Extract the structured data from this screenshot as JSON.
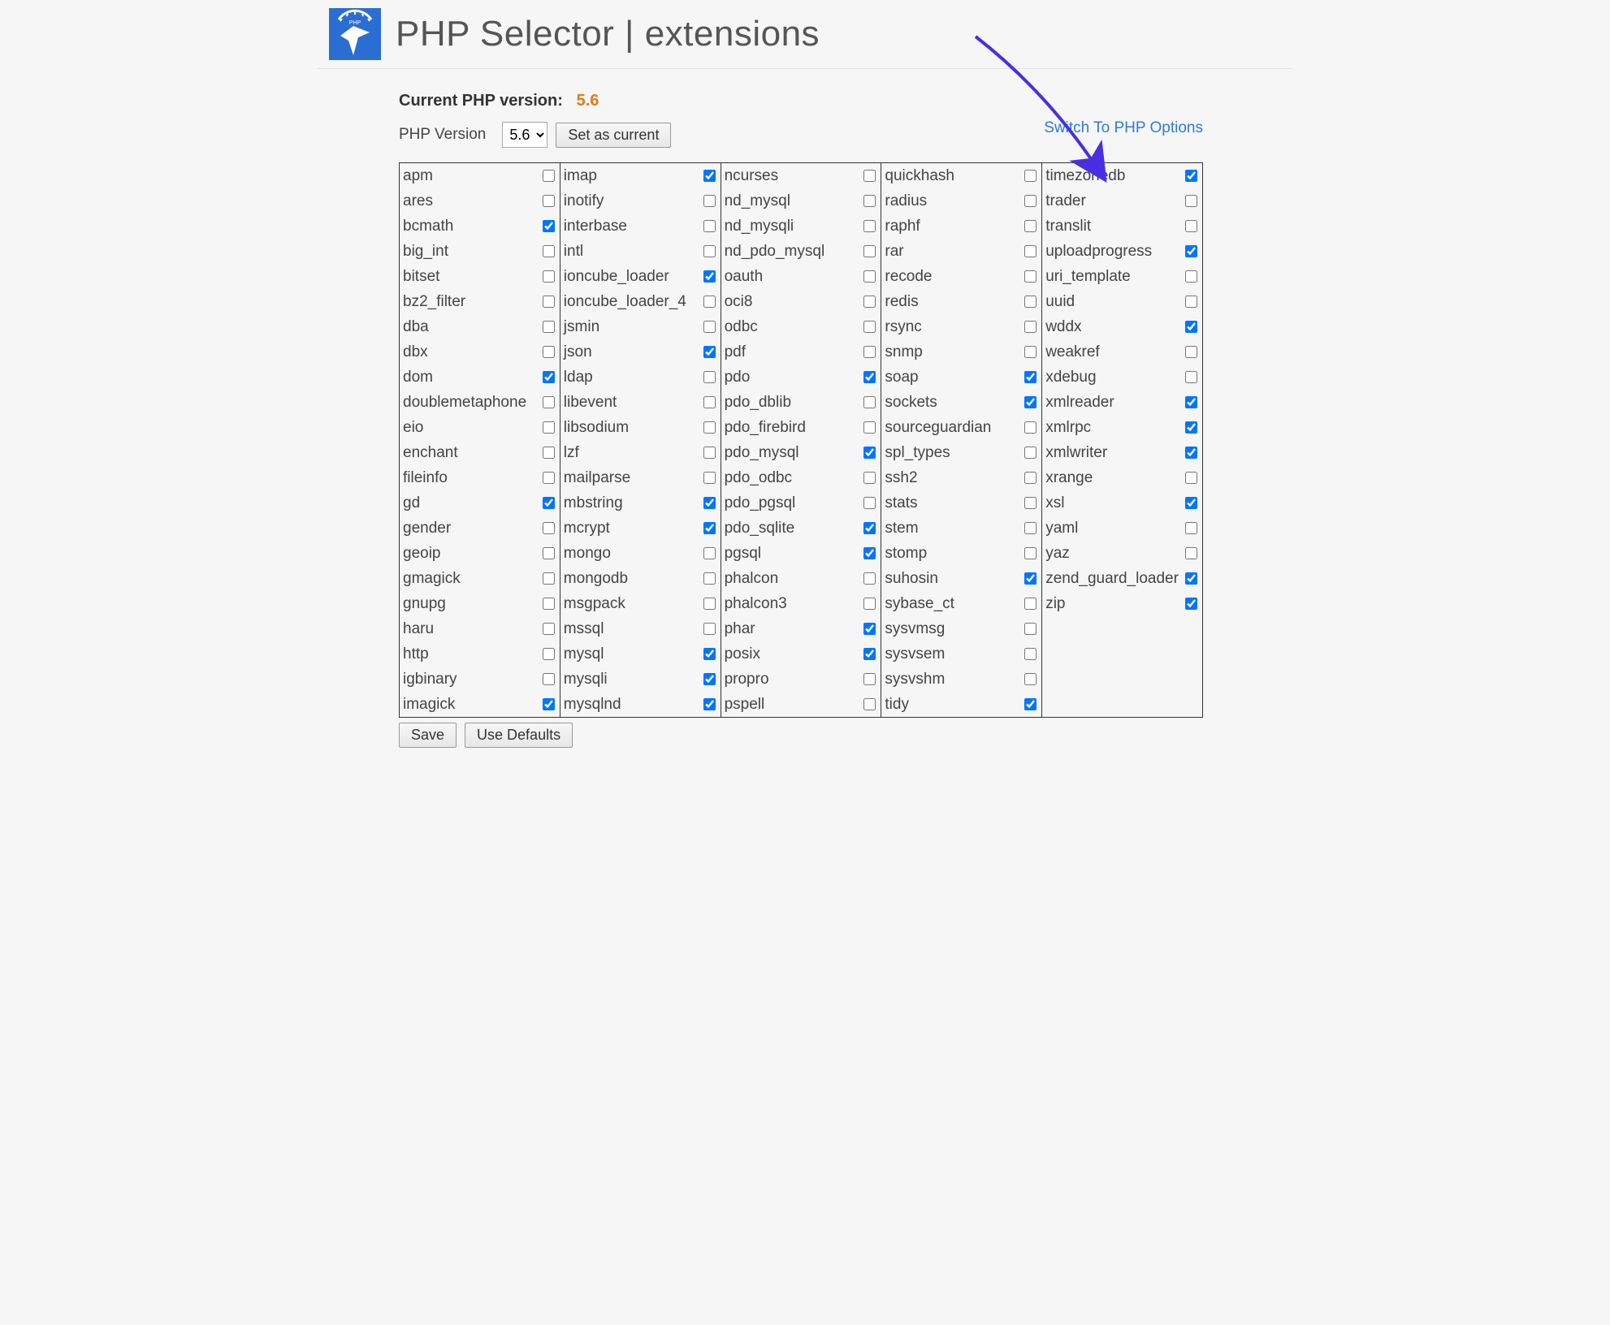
{
  "header": {
    "title": "PHP Selector | extensions"
  },
  "version": {
    "current_label": "Current PHP version:",
    "current_value": "5.6",
    "selector_label": "PHP Version",
    "selected": "5.6",
    "options": [
      "5.6"
    ],
    "set_button": "Set as current"
  },
  "switch_link": "Switch To PHP Options",
  "buttons": {
    "save": "Save",
    "defaults": "Use Defaults"
  },
  "columns": [
    [
      {
        "name": "apm",
        "checked": false
      },
      {
        "name": "ares",
        "checked": false
      },
      {
        "name": "bcmath",
        "checked": true
      },
      {
        "name": "big_int",
        "checked": false
      },
      {
        "name": "bitset",
        "checked": false
      },
      {
        "name": "bz2_filter",
        "checked": false
      },
      {
        "name": "dba",
        "checked": false
      },
      {
        "name": "dbx",
        "checked": false
      },
      {
        "name": "dom",
        "checked": true
      },
      {
        "name": "doublemetaphone",
        "checked": false
      },
      {
        "name": "eio",
        "checked": false
      },
      {
        "name": "enchant",
        "checked": false
      },
      {
        "name": "fileinfo",
        "checked": false
      },
      {
        "name": "gd",
        "checked": true
      },
      {
        "name": "gender",
        "checked": false
      },
      {
        "name": "geoip",
        "checked": false
      },
      {
        "name": "gmagick",
        "checked": false
      },
      {
        "name": "gnupg",
        "checked": false
      },
      {
        "name": "haru",
        "checked": false
      },
      {
        "name": "http",
        "checked": false
      },
      {
        "name": "igbinary",
        "checked": false
      },
      {
        "name": "imagick",
        "checked": true
      }
    ],
    [
      {
        "name": "imap",
        "checked": true
      },
      {
        "name": "inotify",
        "checked": false
      },
      {
        "name": "interbase",
        "checked": false
      },
      {
        "name": "intl",
        "checked": false
      },
      {
        "name": "ioncube_loader",
        "checked": true
      },
      {
        "name": "ioncube_loader_4",
        "checked": false
      },
      {
        "name": "jsmin",
        "checked": false
      },
      {
        "name": "json",
        "checked": true
      },
      {
        "name": "ldap",
        "checked": false
      },
      {
        "name": "libevent",
        "checked": false
      },
      {
        "name": "libsodium",
        "checked": false
      },
      {
        "name": "lzf",
        "checked": false
      },
      {
        "name": "mailparse",
        "checked": false
      },
      {
        "name": "mbstring",
        "checked": true
      },
      {
        "name": "mcrypt",
        "checked": true
      },
      {
        "name": "mongo",
        "checked": false
      },
      {
        "name": "mongodb",
        "checked": false
      },
      {
        "name": "msgpack",
        "checked": false
      },
      {
        "name": "mssql",
        "checked": false
      },
      {
        "name": "mysql",
        "checked": true
      },
      {
        "name": "mysqli",
        "checked": true
      },
      {
        "name": "mysqlnd",
        "checked": true
      }
    ],
    [
      {
        "name": "ncurses",
        "checked": false
      },
      {
        "name": "nd_mysql",
        "checked": false
      },
      {
        "name": "nd_mysqli",
        "checked": false
      },
      {
        "name": "nd_pdo_mysql",
        "checked": false
      },
      {
        "name": "oauth",
        "checked": false
      },
      {
        "name": "oci8",
        "checked": false
      },
      {
        "name": "odbc",
        "checked": false
      },
      {
        "name": "pdf",
        "checked": false
      },
      {
        "name": "pdo",
        "checked": true
      },
      {
        "name": "pdo_dblib",
        "checked": false
      },
      {
        "name": "pdo_firebird",
        "checked": false
      },
      {
        "name": "pdo_mysql",
        "checked": true
      },
      {
        "name": "pdo_odbc",
        "checked": false
      },
      {
        "name": "pdo_pgsql",
        "checked": false
      },
      {
        "name": "pdo_sqlite",
        "checked": true
      },
      {
        "name": "pgsql",
        "checked": true
      },
      {
        "name": "phalcon",
        "checked": false
      },
      {
        "name": "phalcon3",
        "checked": false
      },
      {
        "name": "phar",
        "checked": true
      },
      {
        "name": "posix",
        "checked": true
      },
      {
        "name": "propro",
        "checked": false
      },
      {
        "name": "pspell",
        "checked": false
      }
    ],
    [
      {
        "name": "quickhash",
        "checked": false
      },
      {
        "name": "radius",
        "checked": false
      },
      {
        "name": "raphf",
        "checked": false
      },
      {
        "name": "rar",
        "checked": false
      },
      {
        "name": "recode",
        "checked": false
      },
      {
        "name": "redis",
        "checked": false
      },
      {
        "name": "rsync",
        "checked": false
      },
      {
        "name": "snmp",
        "checked": false
      },
      {
        "name": "soap",
        "checked": true
      },
      {
        "name": "sockets",
        "checked": true
      },
      {
        "name": "sourceguardian",
        "checked": false
      },
      {
        "name": "spl_types",
        "checked": false
      },
      {
        "name": "ssh2",
        "checked": false
      },
      {
        "name": "stats",
        "checked": false
      },
      {
        "name": "stem",
        "checked": false
      },
      {
        "name": "stomp",
        "checked": false
      },
      {
        "name": "suhosin",
        "checked": true
      },
      {
        "name": "sybase_ct",
        "checked": false
      },
      {
        "name": "sysvmsg",
        "checked": false
      },
      {
        "name": "sysvsem",
        "checked": false
      },
      {
        "name": "sysvshm",
        "checked": false
      },
      {
        "name": "tidy",
        "checked": true
      }
    ],
    [
      {
        "name": "timezonedb",
        "checked": true
      },
      {
        "name": "trader",
        "checked": false
      },
      {
        "name": "translit",
        "checked": false
      },
      {
        "name": "uploadprogress",
        "checked": true
      },
      {
        "name": "uri_template",
        "checked": false
      },
      {
        "name": "uuid",
        "checked": false
      },
      {
        "name": "wddx",
        "checked": true
      },
      {
        "name": "weakref",
        "checked": false
      },
      {
        "name": "xdebug",
        "checked": false
      },
      {
        "name": "xmlreader",
        "checked": true
      },
      {
        "name": "xmlrpc",
        "checked": true
      },
      {
        "name": "xmlwriter",
        "checked": true
      },
      {
        "name": "xrange",
        "checked": false
      },
      {
        "name": "xsl",
        "checked": true
      },
      {
        "name": "yaml",
        "checked": false
      },
      {
        "name": "yaz",
        "checked": false
      },
      {
        "name": "zend_guard_loader",
        "checked": true
      },
      {
        "name": "zip",
        "checked": true
      }
    ]
  ]
}
